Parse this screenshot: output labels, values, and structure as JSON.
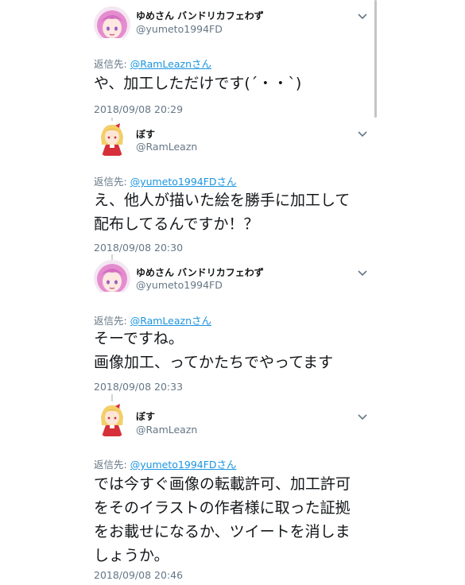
{
  "tweets": [
    {
      "display_name": "ゆめさん バンドリカフェわず",
      "handle": "@yumeto1994FD",
      "reply_prefix": "返信先: ",
      "reply_to": "@RamLeaznさん",
      "text": "や、加工しただけです(´・・`)",
      "timestamp": "2018/09/08 20:29",
      "avatar_icon": "purple-hair-girl-avatar"
    },
    {
      "display_name": "ぼす",
      "handle": "@RamLeazn",
      "reply_prefix": "返信先: ",
      "reply_to": "@yumeto1994FDさん",
      "text": "え、他人が描いた絵を勝手に加工して\n配布してるんですか！？",
      "timestamp": "2018/09/08 20:30",
      "avatar_icon": "blonde-red-dress-girl-avatar"
    },
    {
      "display_name": "ゆめさん バンドリカフェわず",
      "handle": "@yumeto1994FD",
      "reply_prefix": "返信先: ",
      "reply_to": "@RamLeaznさん",
      "text": "そーですね。\n画像加工、ってかたちでやってます",
      "timestamp": "2018/09/08 20:33",
      "avatar_icon": "purple-hair-girl-avatar"
    },
    {
      "display_name": "ぼす",
      "handle": "@RamLeazn",
      "reply_prefix": "返信先: ",
      "reply_to": "@yumeto1994FDさん",
      "text": "では今すぐ画像の転載許可、加工許可\nをそのイラストの作者様に取った証拠\nをお載せになるか、ツイートを消しま\nしょうか。",
      "timestamp": "2018/09/08 20:46",
      "avatar_icon": "blonde-red-dress-girl-avatar"
    }
  ],
  "colors": {
    "link": "#1b95e0",
    "secondary_text": "#657786",
    "primary_text": "#14171a",
    "thread_line": "#ccd6dd"
  }
}
